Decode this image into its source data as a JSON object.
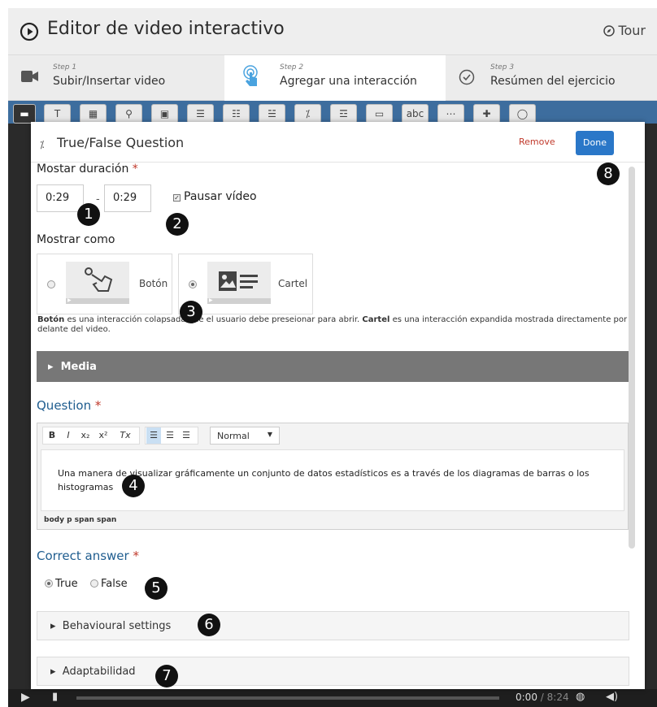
{
  "header": {
    "title": "Editor de video interactivo",
    "tour_label": "Tour"
  },
  "steps": [
    {
      "num": "Step 1",
      "label": "Subir/Insertar video"
    },
    {
      "num": "Step 2",
      "label": "Agregar una interacción"
    },
    {
      "num": "Step 3",
      "label": "Resúmen del ejercicio"
    }
  ],
  "toolbar": {
    "items": [
      "T",
      "▦",
      "⚲",
      "▣",
      "☰",
      "☷",
      "☱",
      "⁒",
      "☲",
      "▭",
      "abc",
      "⋯",
      "✚",
      "◯"
    ]
  },
  "dialog": {
    "title": "True/False Question",
    "remove_label": "Remove",
    "done_label": "Done",
    "duration_label": "Mostar duración",
    "required_mark": "*",
    "start_time": "0:29",
    "end_time": "0:29",
    "dash": "-",
    "pause_label": "Pausar vídeo",
    "pause_checked": true,
    "display_label": "Mostrar como",
    "display_options": [
      {
        "label": "Botón",
        "selected": false
      },
      {
        "label": "Cartel",
        "selected": true
      }
    ],
    "display_desc_1_bold": "Botón",
    "display_desc_1": " es una interacción colapsada que el usuario debe preseionar para abrir. ",
    "display_desc_2_bold": "Cartel",
    "display_desc_2": " es una interacción expandida mostrada directamente por delante del video.",
    "media_label": "Media",
    "question_label": "Question",
    "editor_toolbar": {
      "bold": "B",
      "italic": "I",
      "sub": "x₂",
      "sup": "x²",
      "clear": "Tx",
      "format": "Normal"
    },
    "question_text": "Una manera de visualizar gráficamente un conjunto de datos estadísticos es a través de los diagramas de barras o los histogramas",
    "editor_path": "body  p  span  span",
    "correct_answer_label": "Correct answer",
    "answer_true": "True",
    "answer_false": "False",
    "answer_selected": "True",
    "behavioural_label": "Behavioural settings",
    "adaptability_label": "Adaptabilidad"
  },
  "video": {
    "current_time": "0:00",
    "total_time": "/ 8:24"
  },
  "badges": [
    "1",
    "2",
    "3",
    "4",
    "5",
    "6",
    "7",
    "8"
  ],
  "colors": {
    "accent": "#2a77c8",
    "section_title": "#1f5d8f",
    "required": "#c0392b",
    "media_bar": "#777777"
  }
}
